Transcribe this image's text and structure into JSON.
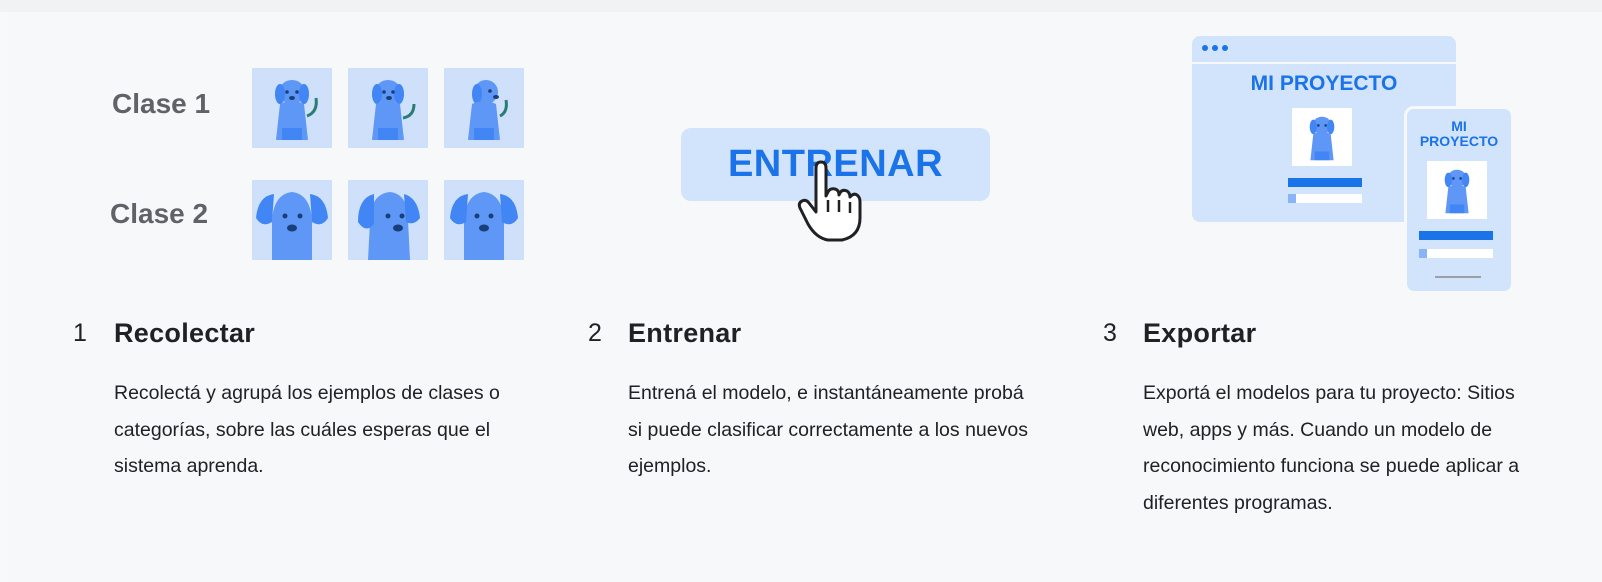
{
  "collect": {
    "class1_label": "Clase 1",
    "class2_label": "Clase 2",
    "step_number": "1",
    "title": "Recolectar",
    "description": "Recolectá y agrupá los ejemplos de clases o categorías, sobre las cuáles esperas que el sistema aprenda."
  },
  "train": {
    "button_label": "ENTRENAR",
    "step_number": "2",
    "title": "Entrenar",
    "description": "Entrená el modelo, e instantáneamente probá si puede clasificar correctamente a los nuevos ejemplos."
  },
  "export": {
    "desktop_title": "MI PROYECTO",
    "mobile_title_line1": "MI",
    "mobile_title_line2": "PROYECTO",
    "step_number": "3",
    "title": "Exportar",
    "description": "Exportá el modelos para tu proyecto: Sitios web, apps y más. Cuando un modelo de reconocimiento funciona se puede aplicar a diferentes programas."
  },
  "colors": {
    "accent": "#1a73e8",
    "tile_bg": "#cfe0fb",
    "dog_fill": "#5e97f6",
    "dog_dark": "#4285f4",
    "button_bg": "#d2e3fc"
  },
  "icons": [
    "sitting-dog-icon",
    "dog-face-icon",
    "hand-pointer-icon",
    "browser-window-icon",
    "mobile-phone-icon"
  ]
}
